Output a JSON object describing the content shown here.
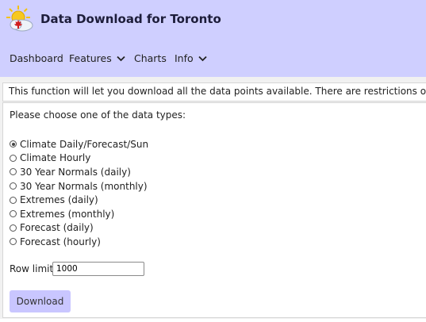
{
  "header": {
    "title": "Data Download for Toronto",
    "logo_icon": "sun-cloud-maple-leaf-icon",
    "background": "#cfcfff"
  },
  "nav": {
    "items": [
      {
        "label": "Dashboard",
        "has_dropdown": false
      },
      {
        "label": "Features",
        "has_dropdown": true
      },
      {
        "label": "Charts",
        "has_dropdown": false
      },
      {
        "label": "Info",
        "has_dropdown": true
      }
    ]
  },
  "info": {
    "text": "This function will let you download all the data points available. There are restrictions on your use of t"
  },
  "form": {
    "prompt": "Please choose one of the data types:",
    "options": [
      {
        "label": "Climate Daily/Forecast/Sun",
        "checked": true
      },
      {
        "label": "Climate Hourly",
        "checked": false
      },
      {
        "label": "30 Year Normals (daily)",
        "checked": false
      },
      {
        "label": "30 Year Normals (monthly)",
        "checked": false
      },
      {
        "label": "Extremes (daily)",
        "checked": false
      },
      {
        "label": "Extremes (monthly)",
        "checked": false
      },
      {
        "label": "Forecast (daily)",
        "checked": false
      },
      {
        "label": "Forecast (hourly)",
        "checked": false
      }
    ],
    "row_limit_label": "Row limit:",
    "row_limit_value": "1000",
    "download_label": "Download",
    "button_color": "#c9c6ff"
  }
}
